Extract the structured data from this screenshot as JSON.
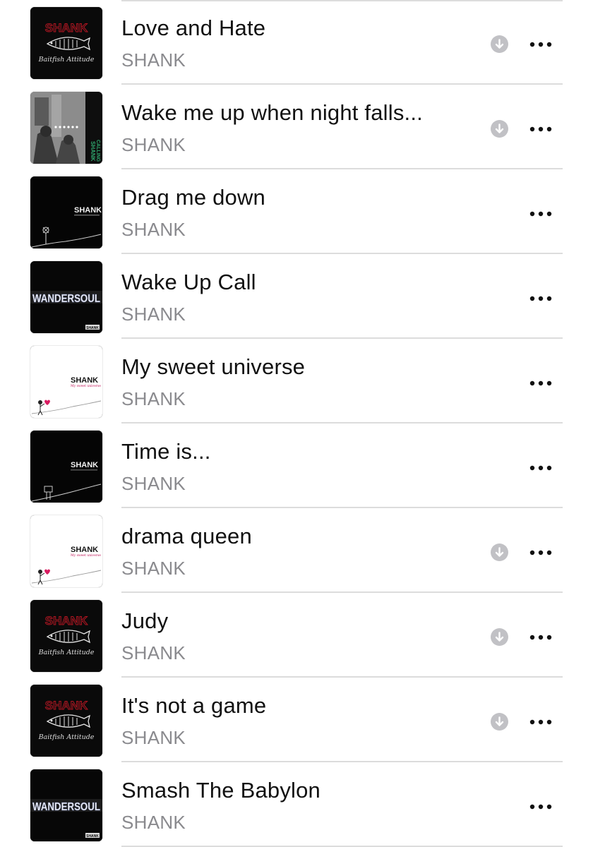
{
  "songs": [
    {
      "title": "Love and Hate",
      "artist": "SHANK",
      "downloaded": true,
      "art": "baitfish",
      "art_text": [
        "SHANK",
        "Baitfish Attitude"
      ]
    },
    {
      "title": "Wake me up when night falls...",
      "artist": "SHANK",
      "downloaded": true,
      "art": "calling",
      "art_text": [
        "SHANK",
        "CALLING"
      ]
    },
    {
      "title": "Drag me down",
      "artist": "SHANK",
      "downloaded": false,
      "art": "dark-flower",
      "art_text": [
        "SHANK"
      ]
    },
    {
      "title": "Wake Up Call",
      "artist": "SHANK",
      "downloaded": false,
      "art": "wandersoul",
      "art_text": [
        "WANDERSOUL",
        "SHANK"
      ]
    },
    {
      "title": "My sweet universe",
      "artist": "SHANK",
      "downloaded": false,
      "art": "sweet-universe",
      "art_text": [
        "SHANK",
        "My sweet universe"
      ]
    },
    {
      "title": "Time is...",
      "artist": "SHANK",
      "downloaded": false,
      "art": "dark-sign",
      "art_text": [
        "SHANK"
      ]
    },
    {
      "title": "drama queen",
      "artist": "SHANK",
      "downloaded": true,
      "art": "sweet-universe",
      "art_text": [
        "SHANK",
        "My sweet universe"
      ]
    },
    {
      "title": "Judy",
      "artist": "SHANK",
      "downloaded": true,
      "art": "baitfish",
      "art_text": [
        "SHANK",
        "Baitfish Attitude"
      ]
    },
    {
      "title": "It's not a game",
      "artist": "SHANK",
      "downloaded": true,
      "art": "baitfish",
      "art_text": [
        "SHANK",
        "Baitfish Attitude"
      ]
    },
    {
      "title": "Smash The Babylon",
      "artist": "SHANK",
      "downloaded": false,
      "art": "wandersoul",
      "art_text": [
        "WANDERSOUL",
        "SHANK"
      ]
    }
  ],
  "icons": {
    "download": "download-icon",
    "more": "more-options-icon"
  },
  "colors": {
    "title": "#111111",
    "artist": "#8a8a8e",
    "download_badge": "#c1c1c5",
    "shank_red": "#b0131f",
    "separator": "#dcdcdc"
  }
}
